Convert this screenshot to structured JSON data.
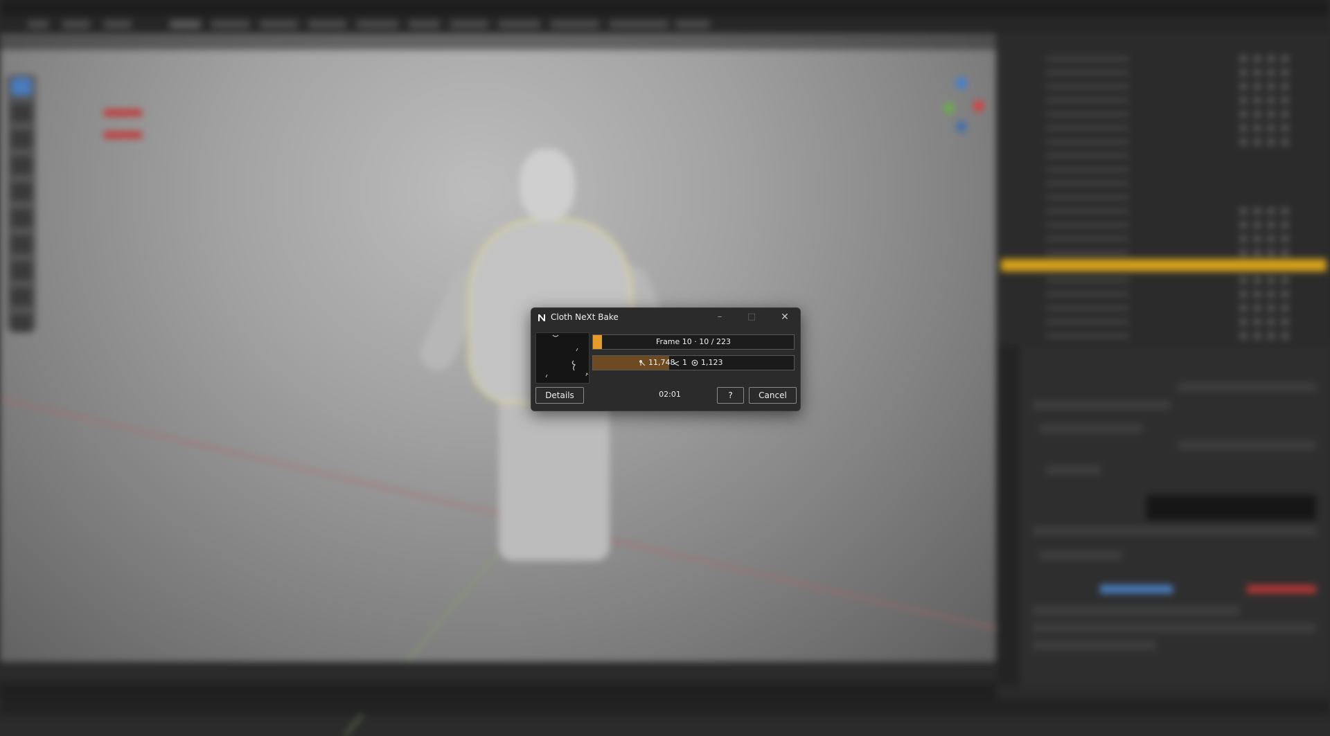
{
  "dialog": {
    "title": "Cloth NeXt Bake",
    "logo_icon": "n-logo-icon",
    "window_controls": [
      "minimize-icon",
      "maximize-icon",
      "close-icon"
    ],
    "progress": {
      "label": "Frame 10 · 10 / 223",
      "current": 10,
      "total": 223,
      "fill_color": "#e59a2a"
    },
    "stats": {
      "vertices": "11,748",
      "vertices_icon": "vertex-icon",
      "objects": "1",
      "objects_icon": "angle-icon",
      "collisions": "1,123",
      "collisions_icon": "collision-icon",
      "fill_color": "#6e4a22"
    },
    "timer": "02:01",
    "buttons": {
      "details": "Details",
      "help": "?",
      "cancel": "Cancel"
    }
  },
  "background": {
    "accent_selected_row": "#d4a21a",
    "axis_red": "#b86262",
    "axis_green": "#8aa36a"
  }
}
